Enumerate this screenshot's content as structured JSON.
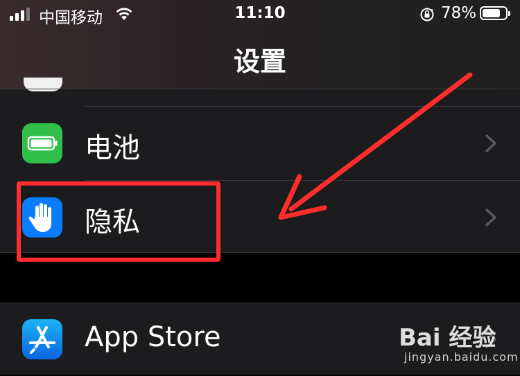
{
  "status_bar": {
    "carrier": "中国移动",
    "time": "11:10",
    "battery_percent": "78%",
    "battery_level": 0.78,
    "signal_bars": 3,
    "signal_total": 4
  },
  "nav": {
    "title": "设置"
  },
  "settings_rows": [
    {
      "label": "电池",
      "icon": "battery-icon",
      "icon_color": "#30c04a"
    },
    {
      "label": "隐私",
      "icon": "hand-icon",
      "icon_color": "#0a7cff"
    },
    {
      "label": "App Store",
      "icon": "app-store-icon",
      "icon_color": "#1a8cf0"
    }
  ],
  "annotation": {
    "color": "#ff2d2d",
    "highlighted_row": "隐私"
  },
  "watermark": {
    "brand": "Bai 经验",
    "url": "jingyan.baidu.com"
  }
}
